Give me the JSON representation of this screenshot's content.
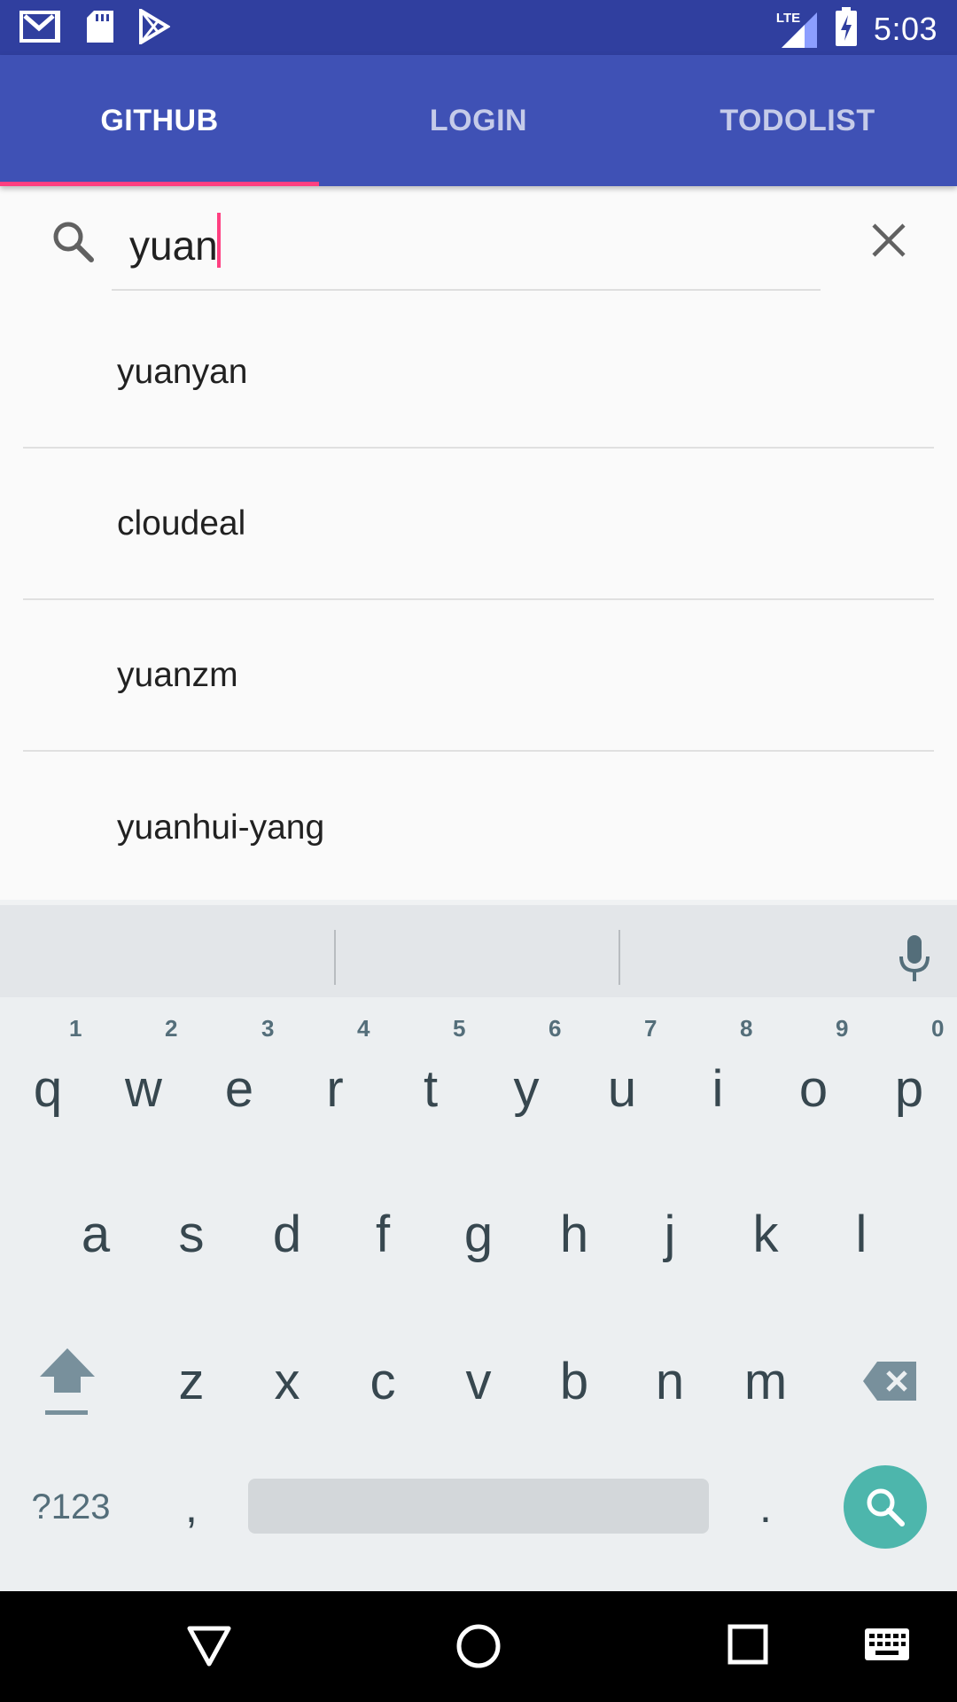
{
  "status_bar": {
    "time": "5:03",
    "network_label": "LTE",
    "icons": [
      "gmail-icon",
      "sd-card-icon",
      "play-store-icon",
      "signal-icon",
      "battery-charging-icon"
    ]
  },
  "tabs": [
    {
      "label": "GITHUB",
      "active": true
    },
    {
      "label": "LOGIN",
      "active": false
    },
    {
      "label": "TODOLIST",
      "active": false
    }
  ],
  "search": {
    "value": "yuan",
    "placeholder": ""
  },
  "suggestions": [
    "yuanyan",
    "cloudeal",
    "yuanzm",
    "yuanhui-yang"
  ],
  "keyboard": {
    "row1": [
      {
        "key": "q",
        "hint": "1"
      },
      {
        "key": "w",
        "hint": "2"
      },
      {
        "key": "e",
        "hint": "3"
      },
      {
        "key": "r",
        "hint": "4"
      },
      {
        "key": "t",
        "hint": "5"
      },
      {
        "key": "y",
        "hint": "6"
      },
      {
        "key": "u",
        "hint": "7"
      },
      {
        "key": "i",
        "hint": "8"
      },
      {
        "key": "o",
        "hint": "9"
      },
      {
        "key": "p",
        "hint": "0"
      }
    ],
    "row2": [
      "a",
      "s",
      "d",
      "f",
      "g",
      "h",
      "j",
      "k",
      "l"
    ],
    "row3": [
      "z",
      "x",
      "c",
      "v",
      "b",
      "n",
      "m"
    ],
    "symbols_label": "?123",
    "comma_label": ",",
    "period_label": "."
  },
  "colors": {
    "status_bar": "#303f9f",
    "app_bar": "#3f51b5",
    "accent": "#ff4081",
    "search_key": "#4db6ac"
  }
}
